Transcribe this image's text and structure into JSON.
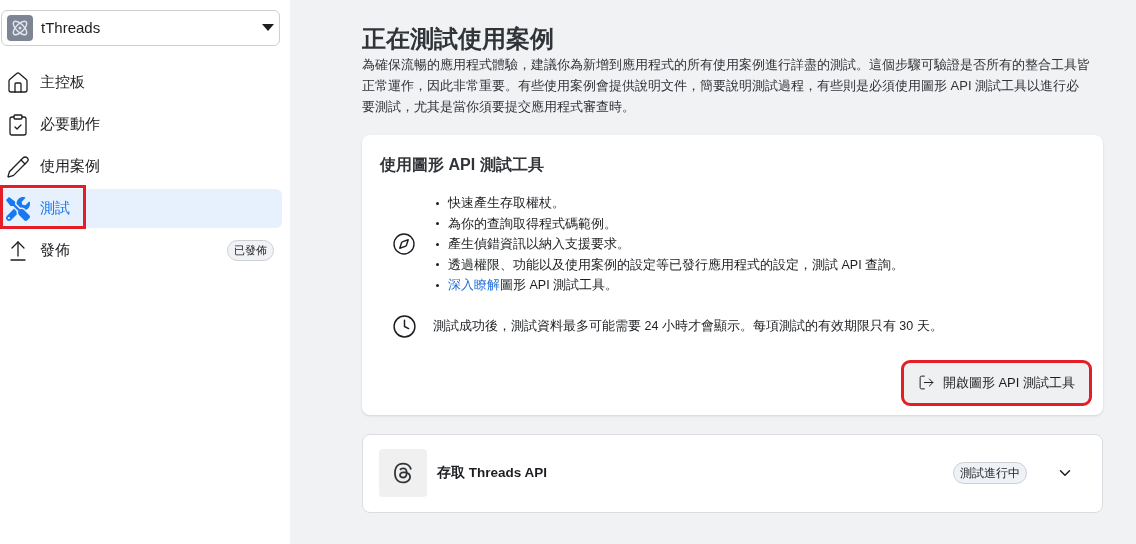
{
  "app_switcher": {
    "name": "tThreads"
  },
  "sidebar": {
    "items": [
      {
        "label": "主控板",
        "selected": false,
        "highlighted": false
      },
      {
        "label": "必要動作",
        "selected": false,
        "highlighted": false
      },
      {
        "label": "使用案例",
        "selected": false,
        "highlighted": false
      },
      {
        "label": "測試",
        "selected": true,
        "highlighted": true
      },
      {
        "label": "發佈",
        "selected": false,
        "highlighted": false,
        "badge": "已發佈"
      }
    ]
  },
  "page": {
    "title": "正在測試使用案例",
    "description": "為確保流暢的應用程式體驗，建議你為新增到應用程式的所有使用案例進行詳盡的測試。這個步驟可驗證是否所有的整合工具皆正常運作，因此非常重要。有些使用案例會提供說明文件，簡要說明測試過程，有些則是必須使用圖形 API 測試工具以進行必要測試，尤其是當你須要提交應用程式審查時。"
  },
  "graph_api_card": {
    "title": "使用圖形 API 測試工具",
    "bullets": [
      {
        "text": "快速產生存取權杖。"
      },
      {
        "text": "為你的查詢取得程式碼範例。"
      },
      {
        "text": "產生偵錯資訊以納入支援要求。"
      },
      {
        "text": "透過權限、功能以及使用案例的設定等已發行應用程式的設定，測試 API 查詢。"
      },
      {
        "link": "深入瞭解",
        "text": "圖形 API 測試工具。"
      }
    ],
    "note": "測試成功後，測試資料最多可能需要 24 小時才會顯示。每項測試的有效期限只有 30 天。",
    "button": {
      "label": "開啟圖形 API 測試工具",
      "highlighted": true
    }
  },
  "use_case": {
    "title": "存取 Threads API",
    "status": "測試進行中",
    "expanded": false
  }
}
